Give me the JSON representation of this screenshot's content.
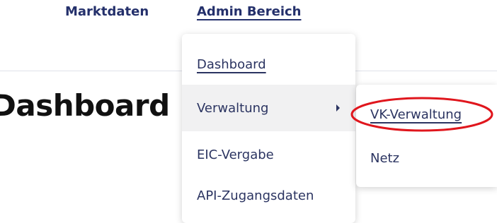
{
  "nav": {
    "items": [
      {
        "label": "Marktdaten"
      },
      {
        "label": "Admin Bereich",
        "active": true
      }
    ]
  },
  "page": {
    "title": "Dashboard"
  },
  "dropdown": {
    "items": [
      {
        "label": "Dashboard"
      },
      {
        "label": "Verwaltung",
        "has_submenu": true,
        "icon": "chevron-right-icon"
      },
      {
        "label": "EIC-Vergabe"
      },
      {
        "label": "API-Zugangsdaten"
      }
    ]
  },
  "submenu": {
    "items": [
      {
        "label": "VK-Verwaltung",
        "highlighted": true
      },
      {
        "label": "Netz"
      }
    ]
  },
  "colors": {
    "nav_text": "#24306b",
    "menu_text": "#2b3461",
    "hover_bg": "#f1f1f2",
    "highlight": "#e0161d"
  }
}
